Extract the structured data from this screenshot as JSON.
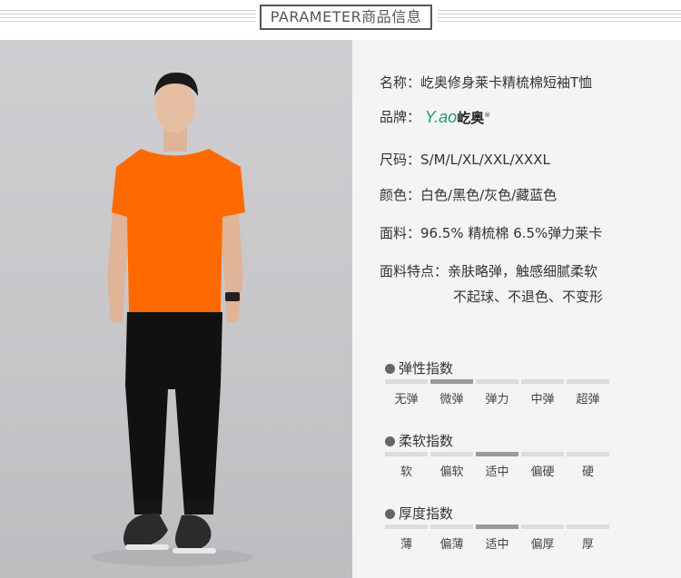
{
  "header": {
    "title": "PARAMETER商品信息"
  },
  "product": {
    "name_label": "名称：",
    "name_value": "屹奥修身莱卡精梳棉短袖T恤",
    "brand_label": "品牌：",
    "brand_logo_text": "Y.ao",
    "brand_logo_cn": "屹奥",
    "brand_logo_reg": "®",
    "size_label": "尺码：",
    "size_value": "S/M/L/XL/XXL/XXXL",
    "color_label": "颜色：",
    "color_value": "白色/黑色/灰色/藏蓝色",
    "fabric_label": "面料：",
    "fabric_value": "96.5% 精梳棉  6.5%弹力莱卡",
    "feature_label": "面料特点：",
    "feature_line1": "亲肤略弹，触感细腻柔软",
    "feature_line2": "不起球、不退色、不变形"
  },
  "indices": [
    {
      "title": "弹性指数",
      "levels": [
        "无弹",
        "微弹",
        "弹力",
        "中弹",
        "超弹"
      ],
      "selected": 1
    },
    {
      "title": "柔软指数",
      "levels": [
        "软",
        "偏软",
        "适中",
        "偏硬",
        "硬"
      ],
      "selected": 2
    },
    {
      "title": "厚度指数",
      "levels": [
        "薄",
        "偏薄",
        "适中",
        "偏厚",
        "厚"
      ],
      "selected": 2
    }
  ],
  "colors": {
    "shirt": "#ff6a00",
    "pants": "#111111",
    "logo": "#1aa06a",
    "active_bar": "#9a9a9a",
    "bar": "#dcdcdc"
  }
}
